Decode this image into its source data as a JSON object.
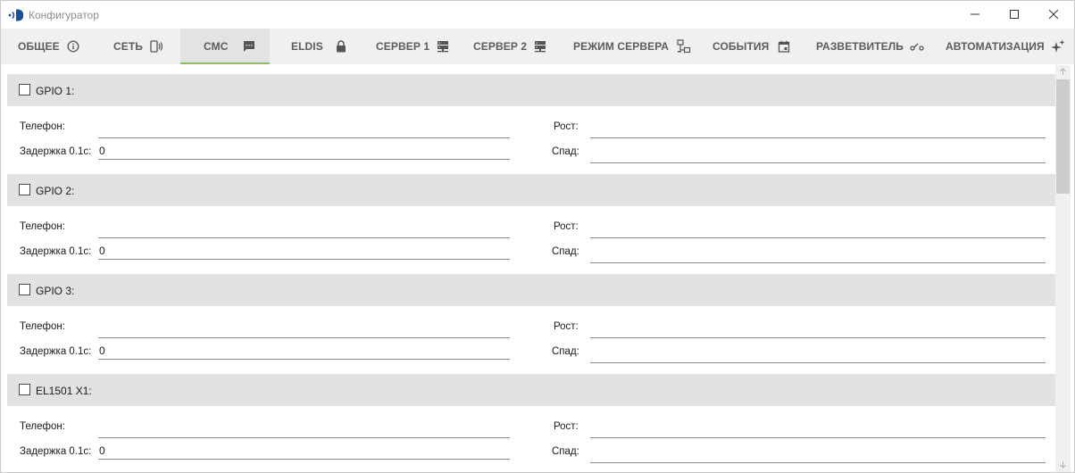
{
  "window": {
    "title": "Конфигуратор",
    "app_icon": "signal-logo-icon",
    "controls": [
      "minimize-icon",
      "maximize-icon",
      "close-icon"
    ]
  },
  "tabs": [
    {
      "label": "ОБЩЕЕ",
      "icon": "info-icon",
      "active": false
    },
    {
      "label": "СЕТЬ",
      "icon": "phone-signal-icon",
      "active": false
    },
    {
      "label": "СМС",
      "icon": "message-icon",
      "active": true
    },
    {
      "label": "ELDIS",
      "icon": "lock-icon",
      "active": false
    },
    {
      "label": "СЕРВЕР 1",
      "icon": "server-icon",
      "active": false
    },
    {
      "label": "СЕРВЕР 2",
      "icon": "server-icon",
      "active": false
    },
    {
      "label": "РЕЖИМ СЕРВЕРА",
      "icon": "network-icon",
      "active": false
    },
    {
      "label": "СОБЫТИЯ",
      "icon": "calendar-icon",
      "active": false
    },
    {
      "label": "РАЗВЕТВИТЕЛЬ",
      "icon": "splitter-icon",
      "active": false
    },
    {
      "label": "АВТОМАТИЗАЦИЯ",
      "icon": "sparkle-icon",
      "active": false
    }
  ],
  "labels": {
    "phone": "Телефон:",
    "delay": "Задержка 0.1с:",
    "rise": "Рост:",
    "fall": "Спад:"
  },
  "sections": [
    {
      "title": "GPIO 1:",
      "checked": false,
      "phone": "",
      "delay": "0",
      "rise": "",
      "fall": ""
    },
    {
      "title": "GPIO 2:",
      "checked": false,
      "phone": "",
      "delay": "0",
      "rise": "",
      "fall": ""
    },
    {
      "title": "GPIO 3:",
      "checked": false,
      "phone": "",
      "delay": "0",
      "rise": "",
      "fall": ""
    },
    {
      "title": "EL1501 X1:",
      "checked": false,
      "phone": "",
      "delay": "0",
      "rise": "",
      "fall": ""
    }
  ],
  "colors": {
    "accent": "#8cc34b",
    "tabbar_bg": "#f0f0f0",
    "section_header_bg": "#e2e2e2"
  }
}
